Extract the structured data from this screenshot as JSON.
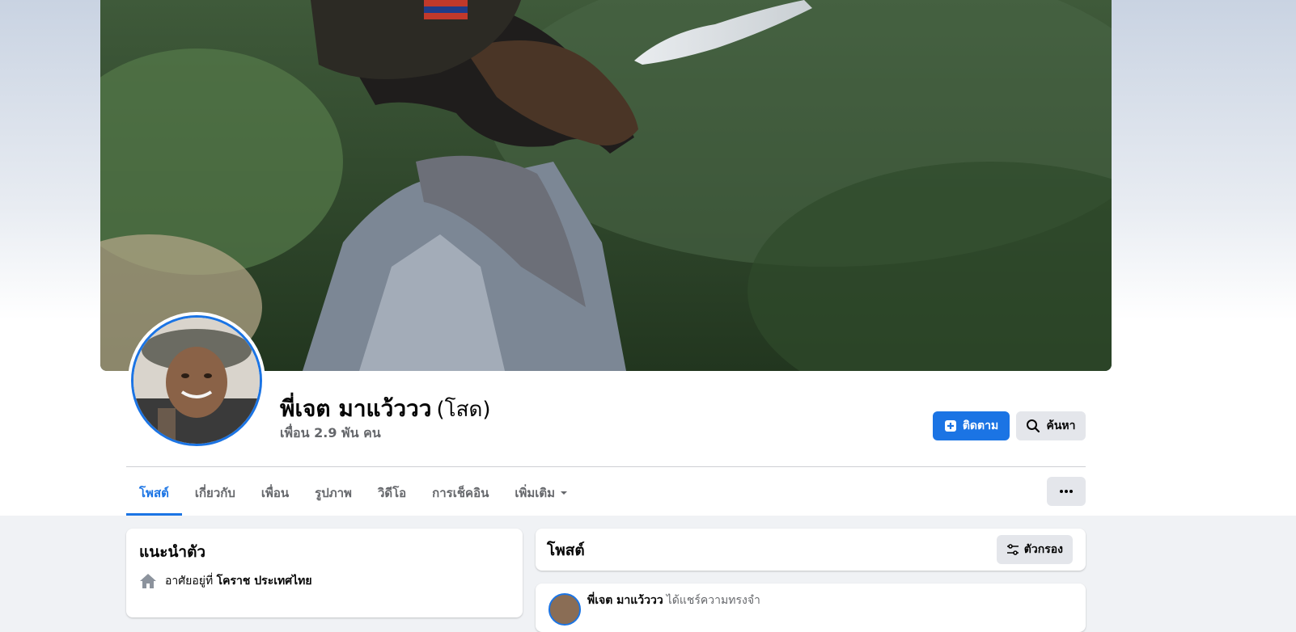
{
  "profile": {
    "name": "พี่เจต มาแว้ววว",
    "status": "(โสด)",
    "friends": "เพื่อน 2.9 พัน คน"
  },
  "actions": {
    "follow_label": "ติดตาม",
    "search_label": "ค้นหา"
  },
  "tabs": [
    {
      "label": "โพสต์",
      "active": true
    },
    {
      "label": "เกี่ยวกับ"
    },
    {
      "label": "เพื่อน"
    },
    {
      "label": "รูปภาพ"
    },
    {
      "label": "วิดีโอ"
    },
    {
      "label": "การเช็คอิน"
    },
    {
      "label": "เพิ่มเติม"
    }
  ],
  "intro": {
    "title": "แนะนำตัว",
    "lives_prefix": "อาศัยอยู่ที่",
    "lives_place": "โคราช ประเทศไทย"
  },
  "posts": {
    "title": "โพสต์",
    "filter_label": "ตัวกรอง"
  },
  "post": {
    "author": "พี่เจต มาแว้ววว",
    "action": "ได้แชร์ความทรงจำ"
  },
  "colors": {
    "accent": "#1b74e4",
    "secondary_button": "#e4e6eb",
    "page_background": "#f0f2f5"
  }
}
